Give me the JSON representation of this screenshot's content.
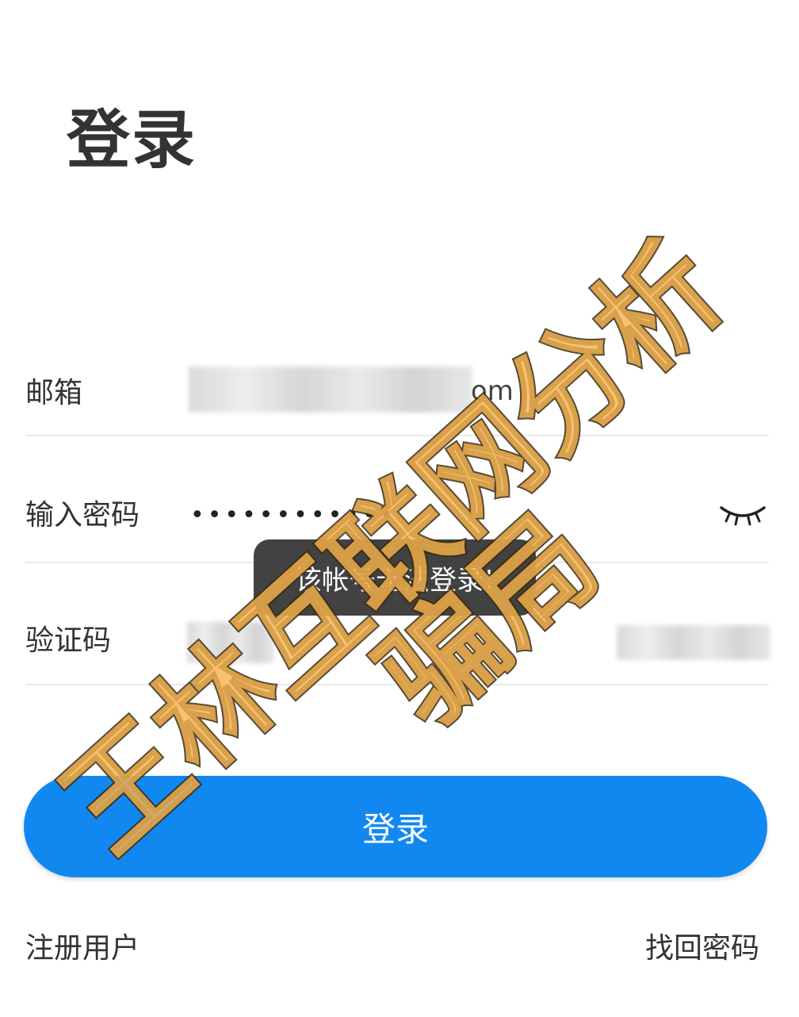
{
  "page": {
    "title": "登录"
  },
  "form": {
    "email": {
      "label": "邮箱",
      "visible_value_suffix": "om"
    },
    "password": {
      "label": "输入密码",
      "masked_value": "••••••••••••",
      "toggle_icon": "eye-closed-icon"
    },
    "captcha": {
      "label": "验证码"
    }
  },
  "toast": {
    "message": "该帐号无法登录!"
  },
  "actions": {
    "login_label": "登录",
    "register_label": "注册用户",
    "forgot_password_label": "找回密码"
  },
  "watermark": {
    "line1": "王林互联网分析",
    "line2": "骗局"
  },
  "colors": {
    "primary_button": "#1188f0",
    "toast_background": "#2a2a2a",
    "watermark_fill": "#f6b551"
  }
}
